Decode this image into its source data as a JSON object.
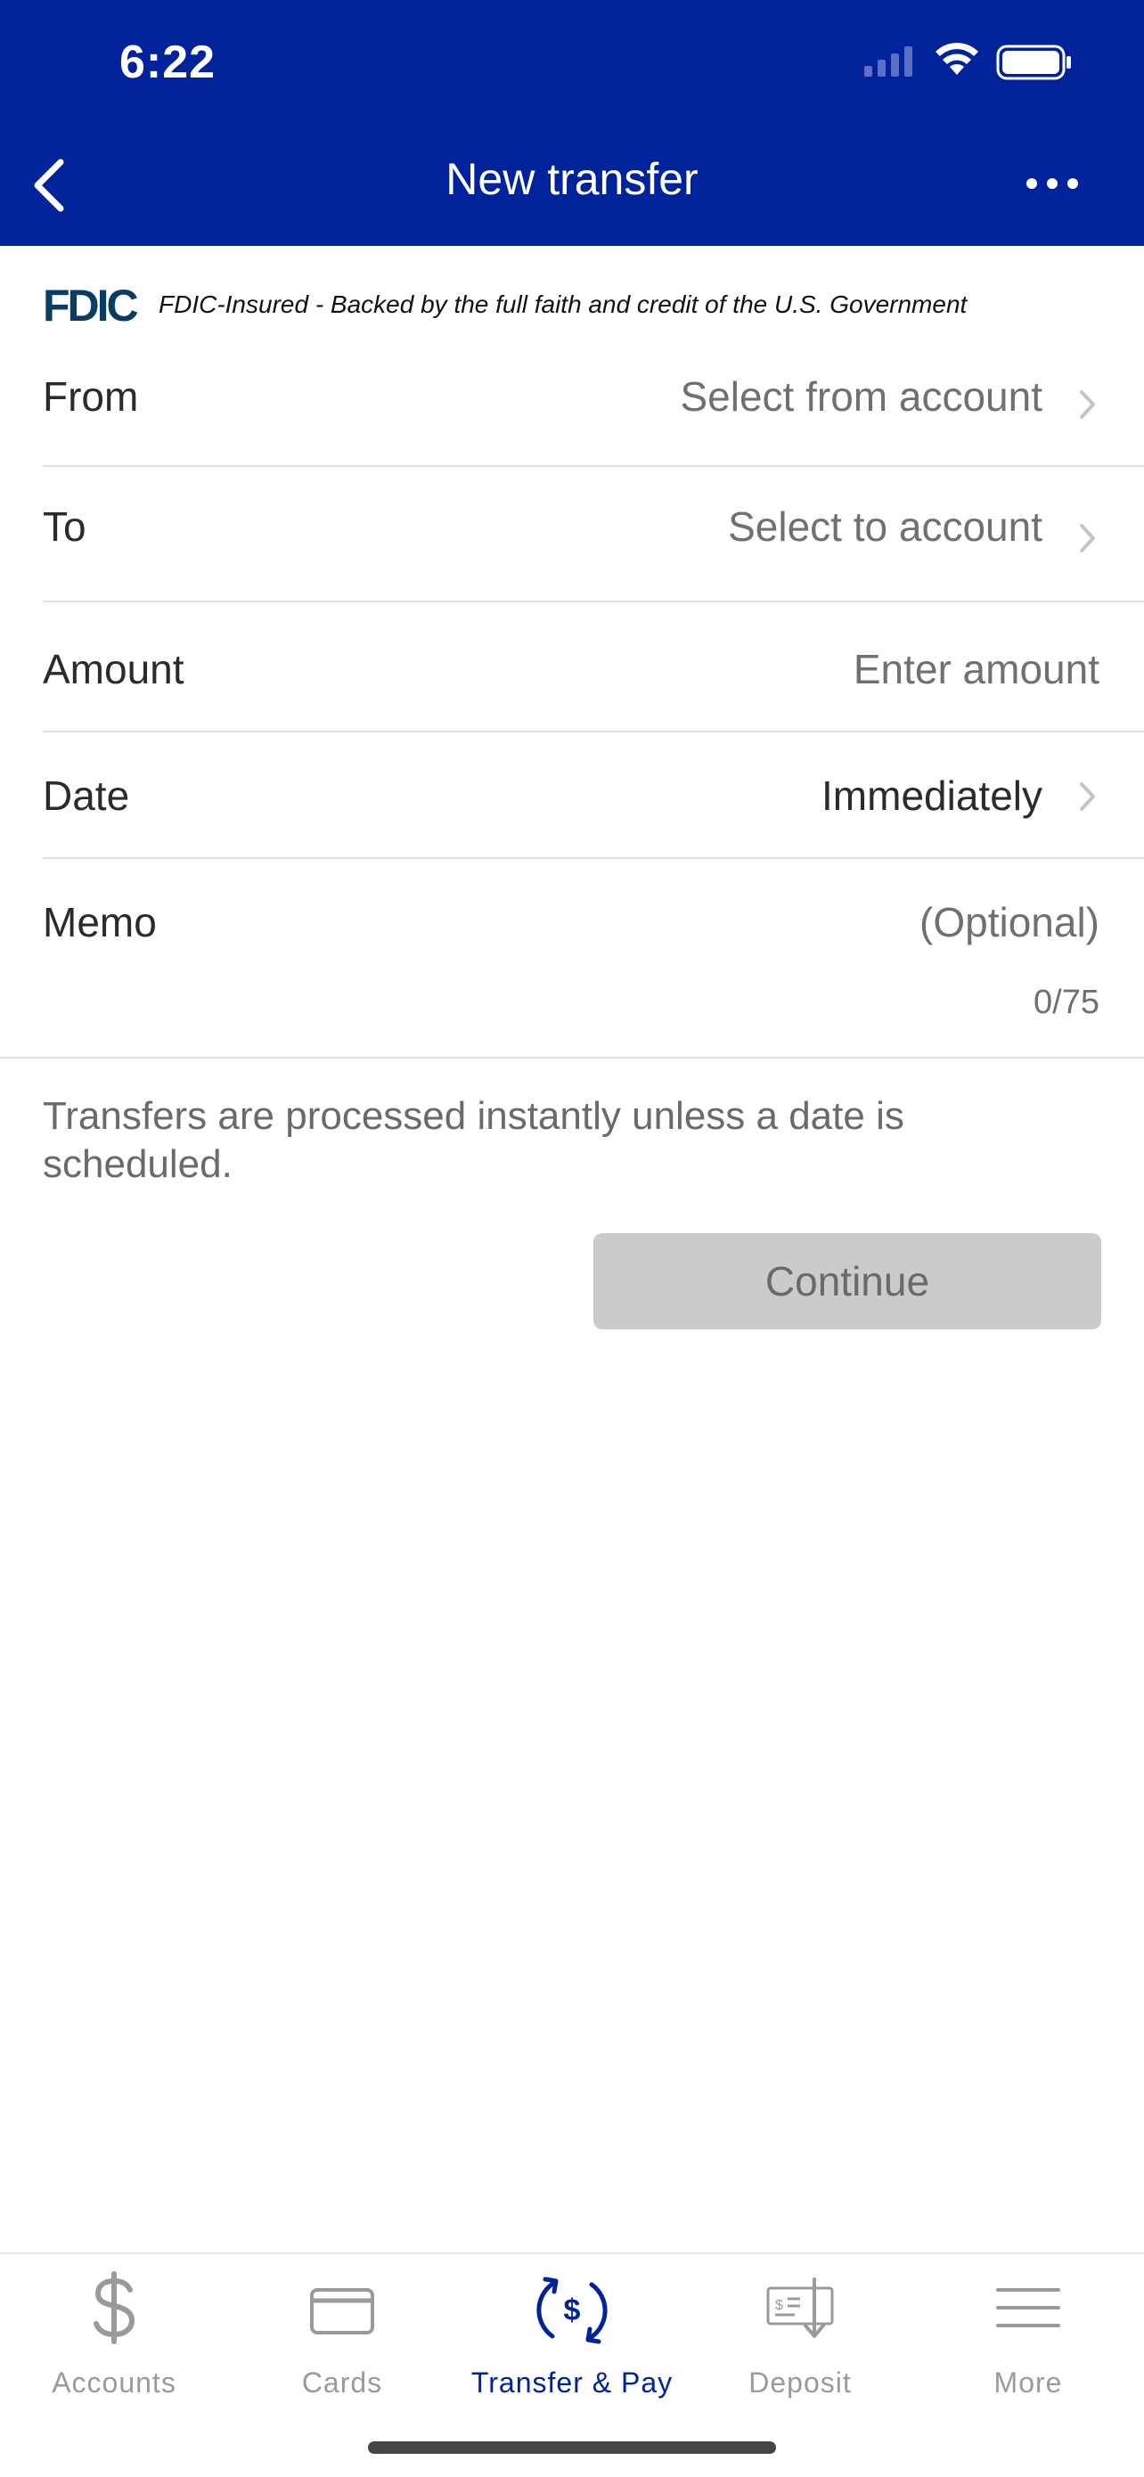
{
  "status_bar": {
    "time": "6:22"
  },
  "nav": {
    "title": "New transfer"
  },
  "fdic": {
    "logo_text": "FDIC",
    "text": "FDIC-Insured - Backed by the full faith and credit of the U.S. Government"
  },
  "form": {
    "from": {
      "label": "From",
      "value": "Select from account"
    },
    "to": {
      "label": "To",
      "value": "Select to account"
    },
    "amount": {
      "label": "Amount",
      "placeholder": "Enter amount"
    },
    "date": {
      "label": "Date",
      "value": "Immediately"
    },
    "memo": {
      "label": "Memo",
      "placeholder": "(Optional)",
      "counter": "0/75"
    }
  },
  "info_text": "Transfers are processed instantly unless a date is scheduled.",
  "continue_label": "Continue",
  "tabs": [
    {
      "label": "Accounts",
      "icon": "dollar-icon"
    },
    {
      "label": "Cards",
      "icon": "card-icon"
    },
    {
      "label": "Transfer & Pay",
      "icon": "transfer-pay-icon",
      "active": true
    },
    {
      "label": "Deposit",
      "icon": "deposit-check-icon"
    },
    {
      "label": "More",
      "icon": "hamburger-menu-icon"
    }
  ],
  "colors": {
    "brand": "#00239c",
    "inactive": "#9a9a9a",
    "button_disabled": "#cbcbcb"
  }
}
